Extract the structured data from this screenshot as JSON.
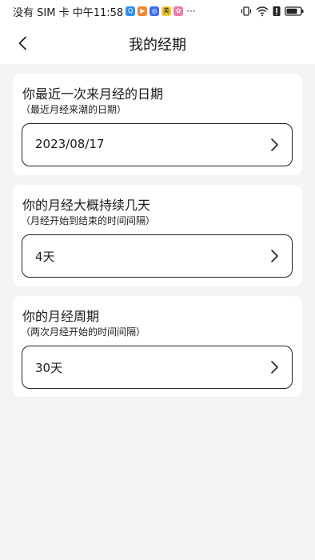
{
  "status_bar": {
    "left_text": "没有 SIM 卡 中午11:58",
    "more": "···",
    "app_icons": [
      {
        "name": "qq-icon",
        "color": "#2f8ff5",
        "glyph": "Q"
      },
      {
        "name": "video-icon",
        "color": "#f5852f",
        "glyph": "▶"
      },
      {
        "name": "browser-icon",
        "color": "#3a6cf5",
        "glyph": "◎"
      },
      {
        "name": "meituan-icon",
        "color": "#f5c92f",
        "glyph": "美"
      },
      {
        "name": "gallery-icon",
        "color": "#f07aa8",
        "glyph": "✿"
      }
    ]
  },
  "header": {
    "title": "我的经期",
    "back_icon": "chevron-left-icon"
  },
  "cards": [
    {
      "title": "你最近一次来月经的日期",
      "subtitle": "（最近月经来潮的日期）",
      "value": "2023/08/17"
    },
    {
      "title": "你的月经大概持续几天",
      "subtitle": "（月经开始到结束的时间间隔）",
      "value": "4天"
    },
    {
      "title": "你的月经周期",
      "subtitle": "（两次月经开始的时间间隔）",
      "value": "30天"
    }
  ],
  "colors": {
    "background": "#f4f4f4",
    "card": "#ffffff",
    "field_border": "#222222"
  }
}
